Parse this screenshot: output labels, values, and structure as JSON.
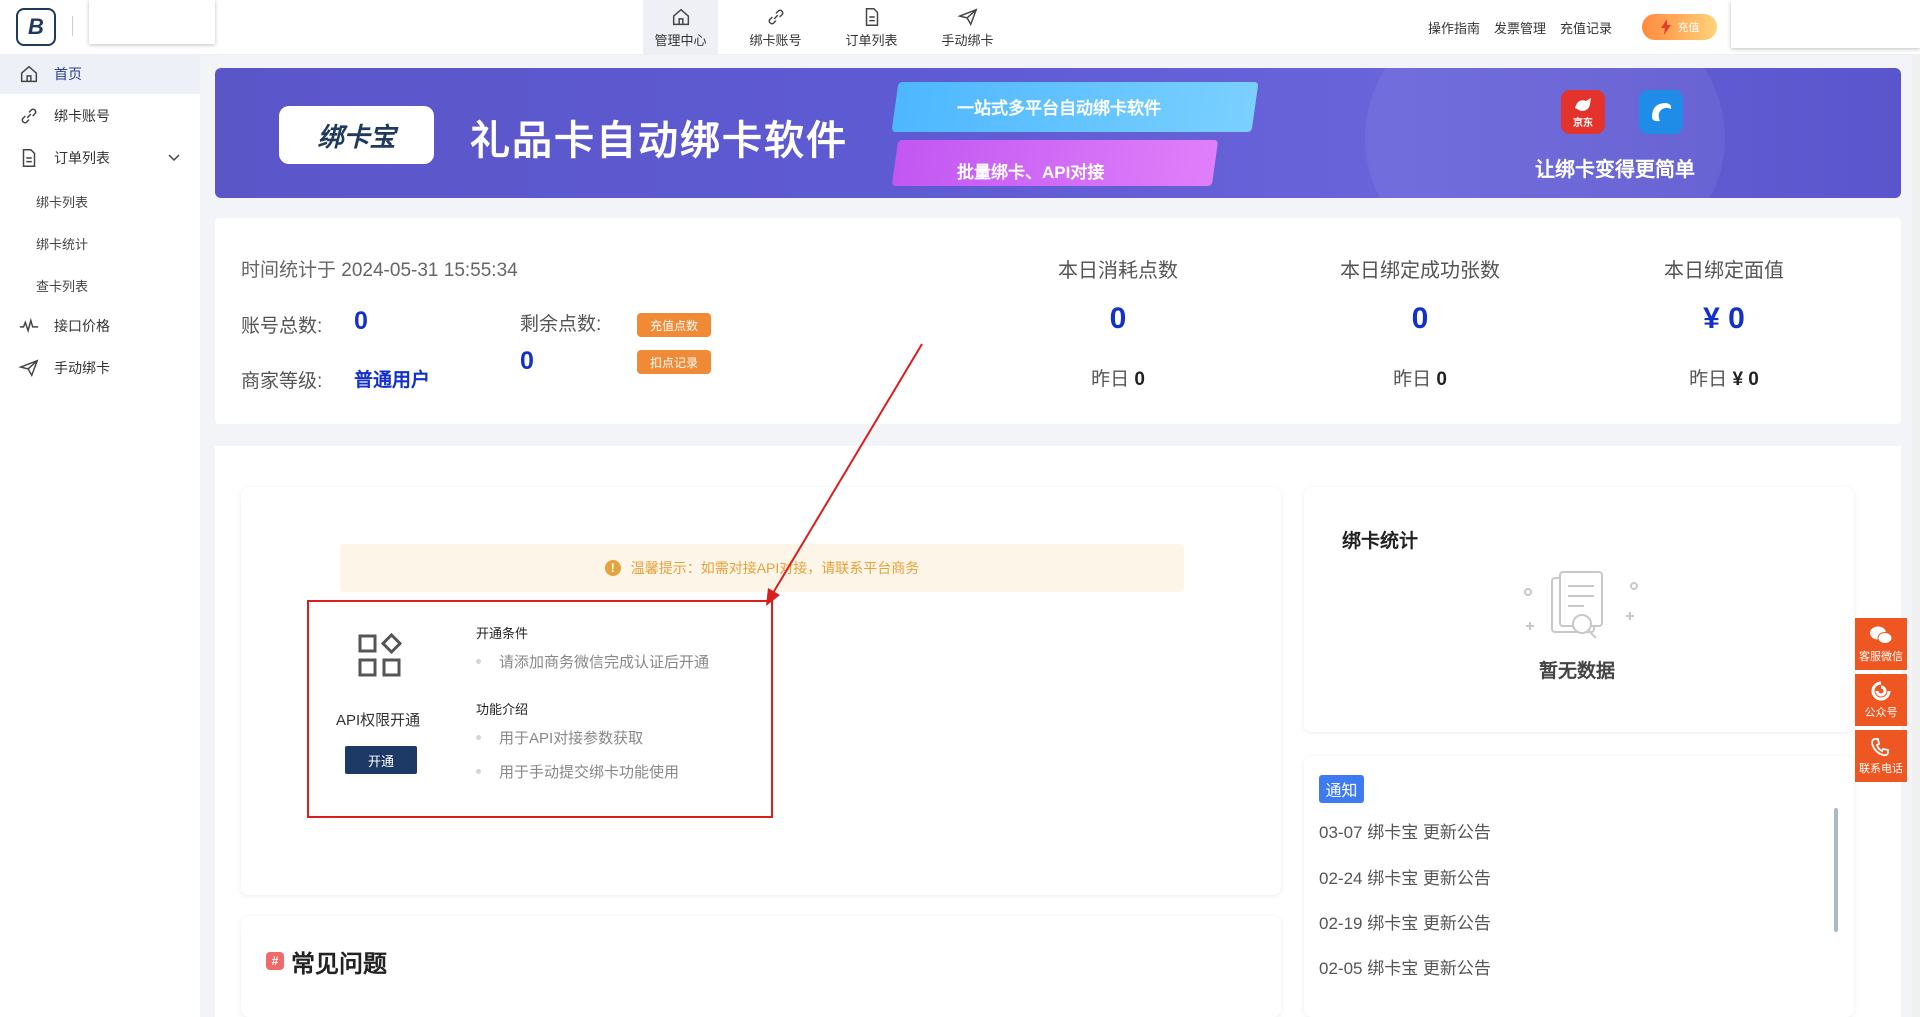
{
  "header": {
    "logo_text": "B",
    "nav": [
      {
        "label": "管理中心",
        "icon": "home-icon"
      },
      {
        "label": "绑卡账号",
        "icon": "link-icon"
      },
      {
        "label": "订单列表",
        "icon": "document-icon"
      },
      {
        "label": "手动绑卡",
        "icon": "send-icon"
      }
    ],
    "links": [
      "操作指南",
      "发票管理",
      "充值记录"
    ],
    "recharge_label": "充值"
  },
  "sidebar": {
    "items": [
      {
        "label": "首页",
        "icon": "home-icon"
      },
      {
        "label": "绑卡账号",
        "icon": "link-icon"
      },
      {
        "label": "订单列表",
        "icon": "document-icon"
      },
      {
        "label": "接口价格",
        "icon": "pulse-icon"
      },
      {
        "label": "手动绑卡",
        "icon": "send-icon"
      }
    ],
    "sub_items": [
      "绑卡列表",
      "绑卡统计",
      "查卡列表"
    ]
  },
  "banner": {
    "logo_text": "绑卡宝",
    "title": "礼品卡自动绑卡软件",
    "tagline1": "一站式多平台自动绑卡软件",
    "tagline2": "批量绑卡、API对接",
    "jd_label": "京东",
    "slogan": "让绑卡变得更简单"
  },
  "stats": {
    "time_label": "时间统计于 2024-05-31 15:55:34",
    "account_total_label": "账号总数:",
    "account_total": "0",
    "points_label": "剩余点数:",
    "points": "0",
    "recharge_points_btn": "充值点数",
    "deduct_record_btn": "扣点记录",
    "level_label": "商家等级:",
    "level": "普通用户",
    "blocks": [
      {
        "label": "本日消耗点数",
        "value": "0",
        "yesterday_label": "昨日",
        "yesterday": "0"
      },
      {
        "label": "本日绑定成功张数",
        "value": "0",
        "yesterday_label": "昨日",
        "yesterday": "0"
      },
      {
        "label": "本日绑定面值",
        "value": "¥ 0",
        "yesterday_label": "昨日",
        "yesterday": "¥ 0"
      }
    ]
  },
  "api": {
    "alert": "温馨提示：如需对接API对接，请联系平台商务",
    "title": "API权限开通",
    "open_btn": "开通",
    "cond_head": "开通条件",
    "cond_items": [
      "请添加商务微信完成认证后开通"
    ],
    "func_head": "功能介绍",
    "func_items": [
      "用于API对接参数获取",
      "用于手动提交绑卡功能使用"
    ]
  },
  "bind_stats": {
    "title": "绑卡统计",
    "empty": "暂无数据"
  },
  "notice": {
    "tag": "通知",
    "items": [
      "03-07 绑卡宝 更新公告",
      "02-24 绑卡宝 更新公告",
      "02-19 绑卡宝 更新公告",
      "02-05 绑卡宝 更新公告"
    ]
  },
  "faq": {
    "title": "常见问题",
    "hash": "#"
  },
  "floating": [
    "客服微信",
    "公众号",
    "联系电话"
  ],
  "colors": {
    "accent": "#1330c9",
    "banner": "#5e5ad2",
    "orange": "#f08a36",
    "red_box": "#d81e1e",
    "float": "#ee5622"
  }
}
